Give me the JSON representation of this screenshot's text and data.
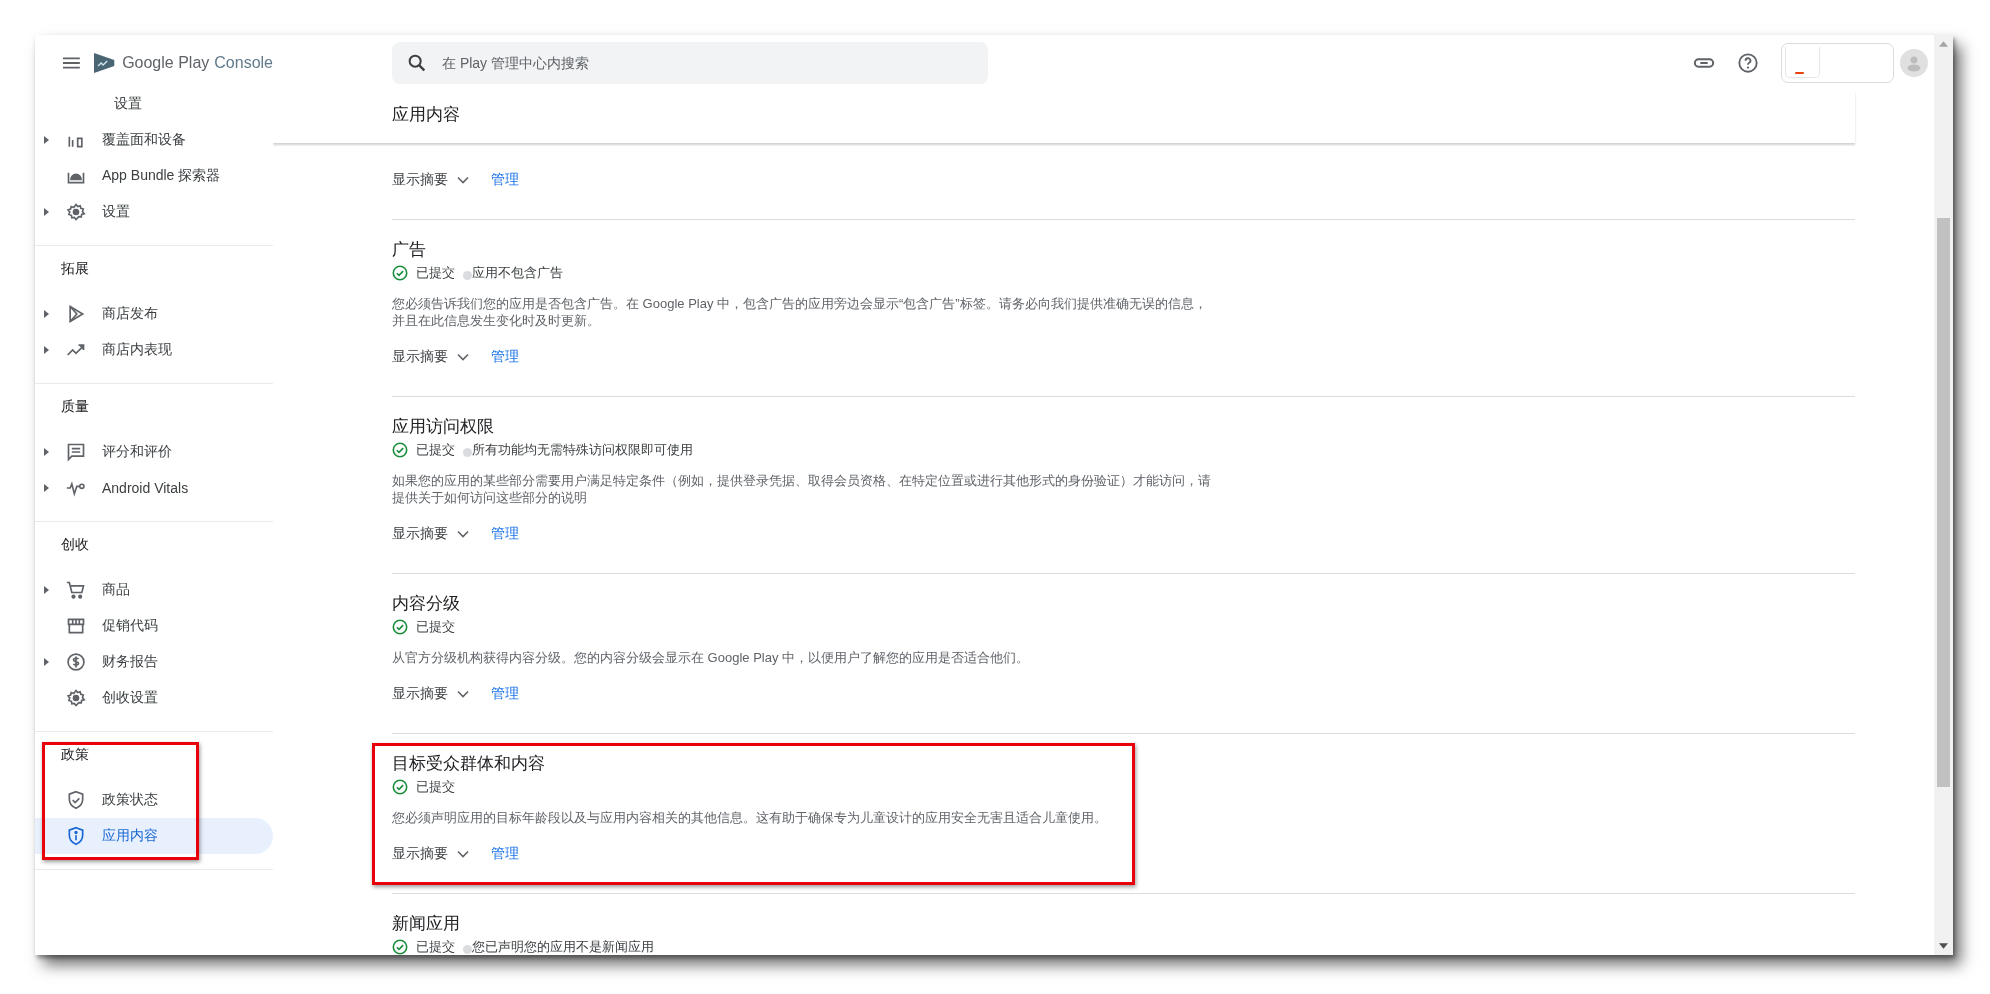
{
  "top_bar": {
    "logo": {
      "brand": "Google Play",
      "product": "Console"
    },
    "search": {
      "placeholder": "在 Play 管理中心内搜索"
    }
  },
  "sidebar": {
    "groups": [
      {
        "items": [
          {
            "label": "设置",
            "kind": "subitem",
            "expandable": false,
            "selected": false
          },
          {
            "label": "覆盖面和设备",
            "kind": "item",
            "expandable": true,
            "selected": false
          },
          {
            "label": "App Bundle 探索器",
            "kind": "item",
            "expandable": false,
            "selected": false
          },
          {
            "label": "设置",
            "kind": "item",
            "expandable": true,
            "selected": false
          }
        ]
      },
      {
        "heading": "拓展",
        "items": [
          {
            "label": "商店发布",
            "kind": "item",
            "expandable": true,
            "selected": false
          },
          {
            "label": "商店内表现",
            "kind": "item",
            "expandable": true,
            "selected": false
          }
        ]
      },
      {
        "heading": "质量",
        "items": [
          {
            "label": "评分和评价",
            "kind": "item",
            "expandable": true,
            "selected": false
          },
          {
            "label": "Android Vitals",
            "kind": "item",
            "expandable": true,
            "selected": false
          }
        ]
      },
      {
        "heading": "创收",
        "items": [
          {
            "label": "商品",
            "kind": "item",
            "expandable": true,
            "selected": false
          },
          {
            "label": "促销代码",
            "kind": "item",
            "expandable": false,
            "selected": false
          },
          {
            "label": "财务报告",
            "kind": "item",
            "expandable": true,
            "selected": false
          },
          {
            "label": "创收设置",
            "kind": "item",
            "expandable": false,
            "selected": false
          }
        ]
      },
      {
        "heading": "政策",
        "highlighted": true,
        "items": [
          {
            "label": "政策状态",
            "kind": "item",
            "expandable": false,
            "selected": false
          },
          {
            "label": "应用内容",
            "kind": "item",
            "expandable": false,
            "selected": true
          }
        ]
      }
    ]
  },
  "page": {
    "title": "应用内容",
    "sections": [
      {
        "summary_toggle": "显示摘要",
        "manage_link": "管理",
        "highlighted": false
      },
      {
        "title": "广告",
        "status": "已提交",
        "note": "应用不包含广告",
        "description": "您必须告诉我们您的应用是否包含广告。在 Google Play 中，包含广告的应用旁边会显示“包含广告”标签。请务必向我们提供准确无误的信息，并且在此信息发生变化时及时更新。",
        "summary_toggle": "显示摘要",
        "manage_link": "管理",
        "highlighted": false
      },
      {
        "title": "应用访问权限",
        "status": "已提交",
        "note": "所有功能均无需特殊访问权限即可使用",
        "description": "如果您的应用的某些部分需要用户满足特定条件（例如，提供登录凭据、取得会员资格、在特定位置或进行其他形式的身份验证）才能访问，请提供关于如何访问这些部分的说明",
        "summary_toggle": "显示摘要",
        "manage_link": "管理",
        "highlighted": false
      },
      {
        "title": "内容分级",
        "status": "已提交",
        "description": "从官方分级机构获得内容分级。您的内容分级会显示在 Google Play 中，以便用户了解您的应用是否适合他们。",
        "summary_toggle": "显示摘要",
        "manage_link": "管理",
        "highlighted": false
      },
      {
        "title": "目标受众群体和内容",
        "status": "已提交",
        "description": "您必须声明应用的目标年龄段以及与应用内容相关的其他信息。这有助于确保专为儿童设计的应用安全无害且适合儿童使用。",
        "summary_toggle": "显示摘要",
        "manage_link": "管理",
        "highlighted": true
      },
      {
        "title": "新闻应用",
        "status": "已提交",
        "note": "您已声明您的应用不是新闻应用",
        "highlighted": false
      }
    ]
  }
}
